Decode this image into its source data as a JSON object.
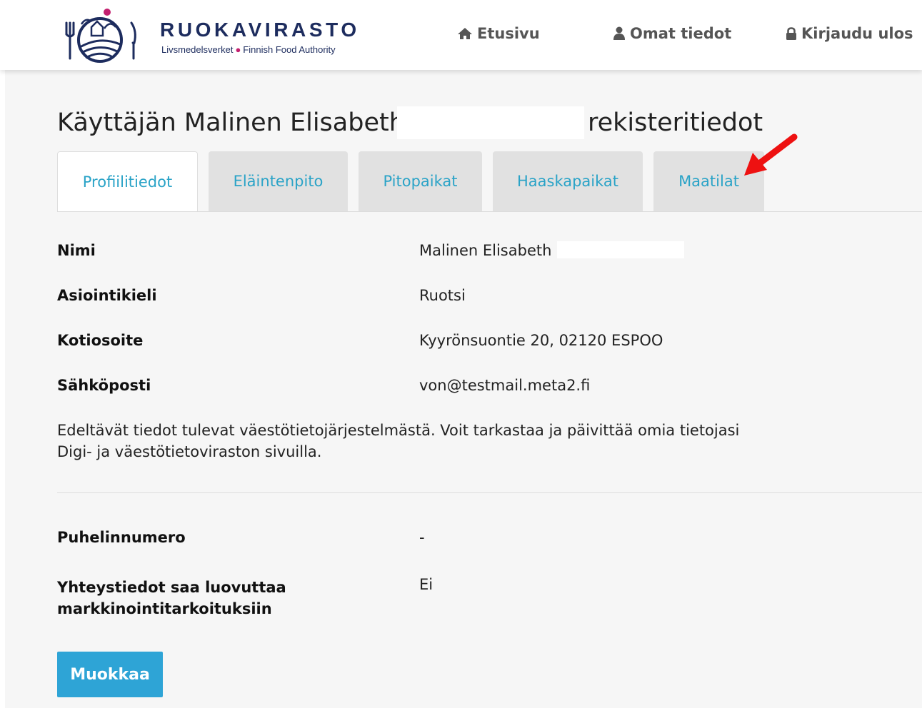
{
  "header": {
    "brand": {
      "name": "RUOKAVIRASTO",
      "sub_left": "Livsmedelsverket",
      "sub_right": "Finnish Food Authority"
    },
    "nav": [
      {
        "label": "Etusivu",
        "icon": "home-icon"
      },
      {
        "label": "Omat tiedot",
        "icon": "user-icon"
      },
      {
        "label": "Kirjaudu ulos",
        "icon": "lock-icon"
      }
    ]
  },
  "page": {
    "title_prefix": "Käyttäjän Malinen Elisabeth",
    "title_suffix": "rekisteritiedot"
  },
  "tabs": [
    {
      "label": "Profiilitiedot",
      "active": true
    },
    {
      "label": "Eläintenpito",
      "active": false
    },
    {
      "label": "Pitopaikat",
      "active": false
    },
    {
      "label": "Haaskapaikat",
      "active": false
    },
    {
      "label": "Maatilat",
      "active": false
    }
  ],
  "profile": {
    "fields": [
      {
        "label": "Nimi",
        "value": "Malinen Elisabeth"
      },
      {
        "label": "Asiointikieli",
        "value": "Ruotsi"
      },
      {
        "label": "Kotiosoite",
        "value": "Kyyrönsuontie 20, 02120 ESPOO"
      },
      {
        "label": "Sähköposti",
        "value": "von@testmail.meta2.fi"
      }
    ],
    "info_line1": "Edeltävät tiedot tulevat väestötietojärjestelmästä. Voit tarkastaa ja päivittää omia tietojasi",
    "info_line2": "Digi- ja väestötietoviraston sivuilla.",
    "contact_fields": [
      {
        "label": "Puhelinnumero",
        "value": "-"
      },
      {
        "label_line1": "Yhteystiedot saa luovuttaa",
        "label_line2": "markkinointitarkoituksiin",
        "value": "Ei"
      }
    ],
    "edit_label": "Muokkaa"
  },
  "colors": {
    "brand_navy": "#1d2c5e",
    "brand_pink": "#c3206f",
    "tab_link": "#2aa3c7",
    "button": "#2ea4d6",
    "arrow": "#ee1111"
  }
}
